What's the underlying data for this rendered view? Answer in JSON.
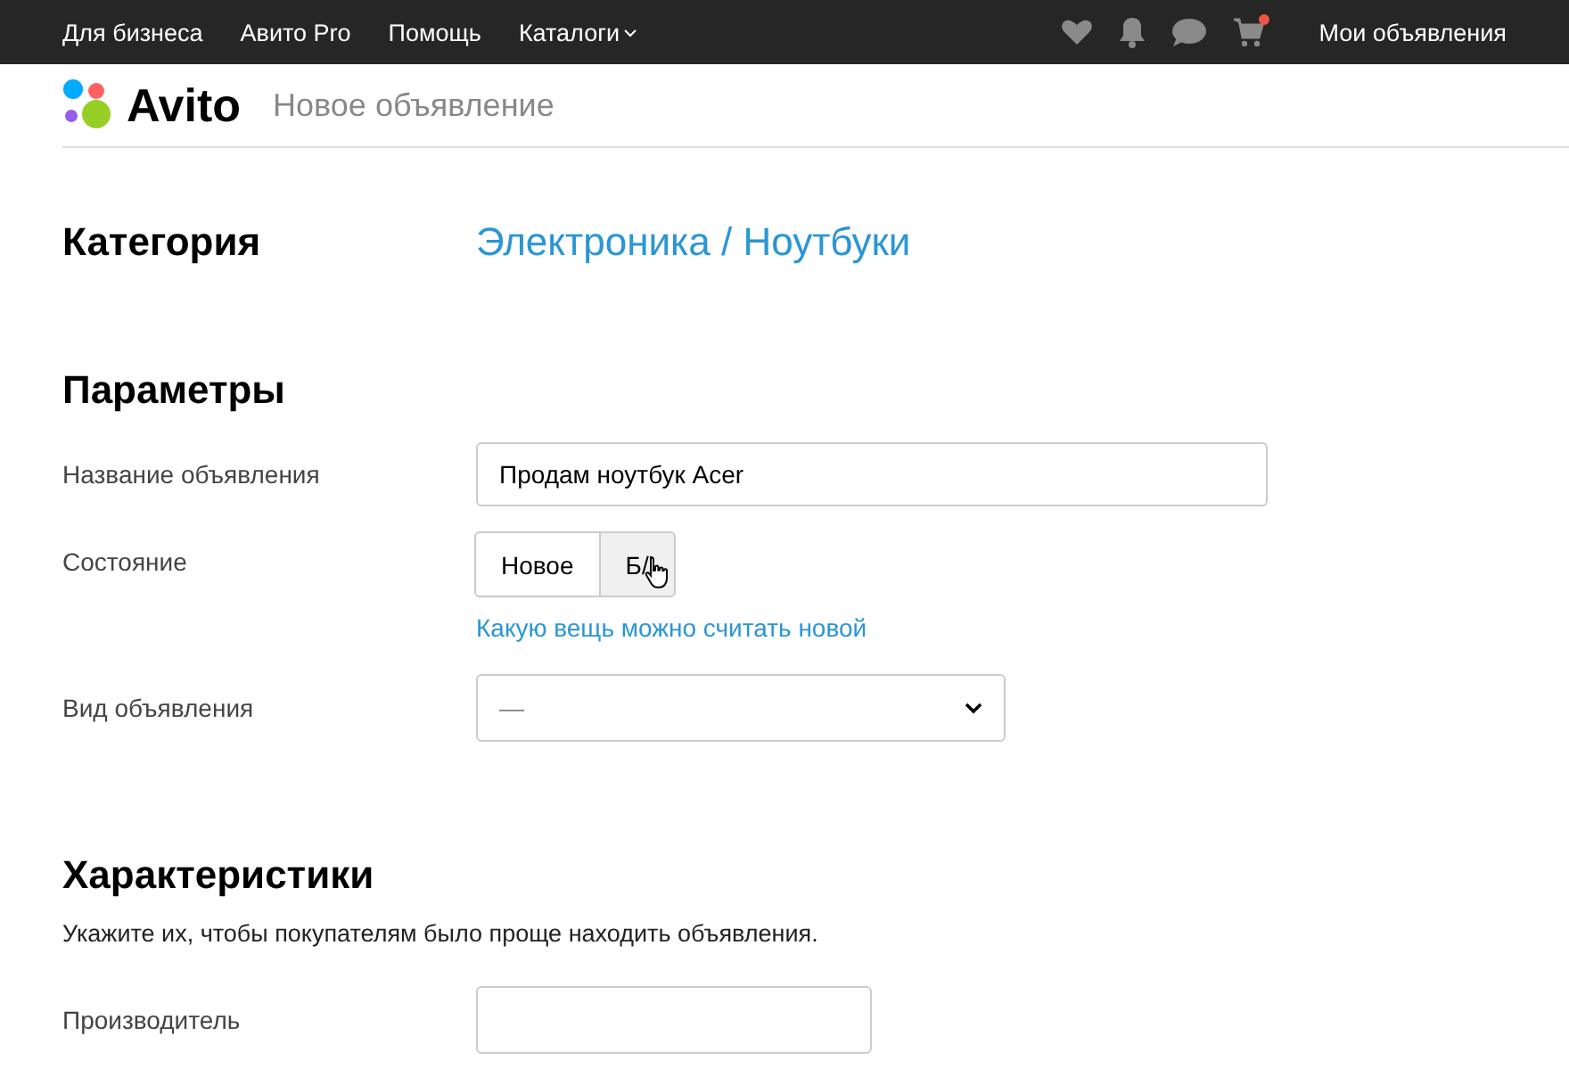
{
  "top_nav": {
    "links": [
      {
        "label": "Для бизнеса"
      },
      {
        "label": "Авито Pro"
      },
      {
        "label": "Помощь"
      },
      {
        "label": "Каталоги",
        "dropdown": true
      }
    ],
    "cart_badge": true,
    "account_link": "Мои объявления"
  },
  "header": {
    "logo": "Avito",
    "page_title": "Новое объявление"
  },
  "category": {
    "heading": "Категория",
    "value": "Электроника / Ноутбуки"
  },
  "parameters": {
    "heading": "Параметры",
    "fields": [
      {
        "kind": "text",
        "label": "Название объявления",
        "value": "Продам ноутбук Acer"
      },
      {
        "kind": "toggle",
        "label": "Состояние",
        "options": [
          {
            "label": "Новое",
            "selected": false,
            "hovered": false
          },
          {
            "label": "Б/",
            "selected": false,
            "hovered": true
          }
        ],
        "help_link": "Какую вещь можно считать новой"
      },
      {
        "kind": "select",
        "label": "Вид объявления",
        "placeholder": "—"
      }
    ]
  },
  "characteristics": {
    "heading": "Характеристики",
    "description": "Укажите их, чтобы покупателям было проще находить объявления.",
    "fields": [
      {
        "kind": "short_text",
        "label": "Производитель"
      }
    ]
  }
}
